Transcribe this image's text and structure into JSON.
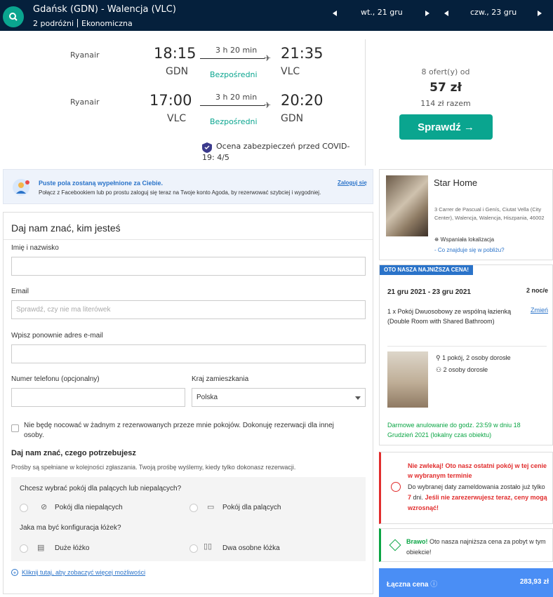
{
  "topbar": {
    "route": "Gdańsk (GDN) - Walencja (VLC)",
    "travellers": "2 podróżni",
    "cabin": "Ekonomiczna",
    "depart_date": "wt., 21 gru",
    "return_date": "czw., 23 gru",
    "logo_icon": "search-icon"
  },
  "flights": [
    {
      "airline": "Ryanair",
      "dep_time": "18:15",
      "dep_code": "GDN",
      "duration": "3 h 20 min",
      "stops": "Bezpośredni",
      "arr_time": "21:35",
      "arr_code": "VLC"
    },
    {
      "airline": "Ryanair",
      "dep_time": "17:00",
      "dep_code": "VLC",
      "duration": "3 h 20 min",
      "stops": "Bezpośredni",
      "arr_time": "20:20",
      "arr_code": "GDN"
    }
  ],
  "offer": {
    "count": "8 ofert(y) od",
    "price": "57 zł",
    "total": "114 zł razem",
    "button": "Sprawdź →"
  },
  "covid": {
    "line1": "Ocena zabezpieczeń przed COVID-",
    "line2": "19: 4/5"
  },
  "facebook": {
    "title": "Puste pola zostaną wypełnione za Ciebie.",
    "text": "Połącz z Facebookiem lub po prostu zaloguj się teraz na Twoje konto Agoda, by rezerwować szybciej i wygodniej.",
    "login": "Zaloguj się"
  },
  "form": {
    "title": "Daj nam znać, kim jesteś",
    "name_label": "Imię i nazwisko",
    "name_value": "",
    "email_label": "Email",
    "email_placeholder": "Sprawdź, czy nie ma literówek",
    "email2_label": "Wpisz ponownie adres e-mail",
    "phone_label": "Numer telefonu (opcjonalny)",
    "country_label": "Kraj zamieszkania",
    "country_value": "Polska",
    "checkbox_text": "Nie będę nocować w żadnym z rezerwowanych przeze mnie pokojów. Dokonuję rezerwacji dla innej osoby.",
    "needs_title": "Daj nam znać, czego potrzebujesz",
    "needs_sub": "Prośby są spełniane w kolejności zgłaszania. Twoją prośbę wyślemy, kiedy tylko dokonasz rezerwacji.",
    "smoke_q": "Chcesz wybrać pokój dla palących lub niepalących?",
    "non_smoking": "Pokój dla niepalących",
    "smoking": "Pokój dla palących",
    "bed_q": "Jaka ma być konfiguracja łóżek?",
    "big_bed": "Duże łóżko",
    "twin_beds": "Dwa osobne łóżka",
    "more": "Kliknij tutaj, aby zobaczyć więcej możliwości"
  },
  "hotel": {
    "name": "Star Home",
    "address": "3 Carrer de Pascual i Genís, Ciutat Vella (City Center), Walencja, Walencja, Hiszpania, 46002",
    "location": "Wspaniała lokalizacja",
    "nearby": "- Co znajduje się w pobliżu?"
  },
  "price": {
    "badge": "OTO NASZA NAJNIŻSZA CENA!",
    "dates": "21 gru 2021 - 23 gru 2021",
    "nights": "2 noc/e",
    "room": "1 x Pokój Dwuosobowy ze wspólną łazienką (Double Room with Shared Bathroom)",
    "change": "Zmień",
    "occupancy1": "1 pokój, 2 osoby dorosłe",
    "occupancy2": "2 osoby dorosłe",
    "cancel": "Darmowe anulowanie do godz. 23:59 w dniu 18 Grudzień 2021 (lokalny czas obiektu)"
  },
  "alert": {
    "red": "Nie zwlekaj! Oto nasz ostatni pokój w tej cenie w wybranym terminie",
    "text_pre": "Do wybranej daty zameldowania zostało już tylko",
    "days": "7",
    "text_mid": "dni.",
    "text_bold": "Jeśli nie zarezerwujesz teraz, ceny mogą wzrosnąć!"
  },
  "good": {
    "bold": "Brawo!",
    "text": "Oto nasza najniższa cena za pobyt w tym obiekcie!"
  },
  "total": {
    "label": "Łączna cena",
    "value": "283,93 zł"
  },
  "colors": {
    "navy": "#05203c",
    "teal": "#0aa58f",
    "blue": "#2a73c9",
    "red": "#e12d2d",
    "green": "#0aa544"
  }
}
